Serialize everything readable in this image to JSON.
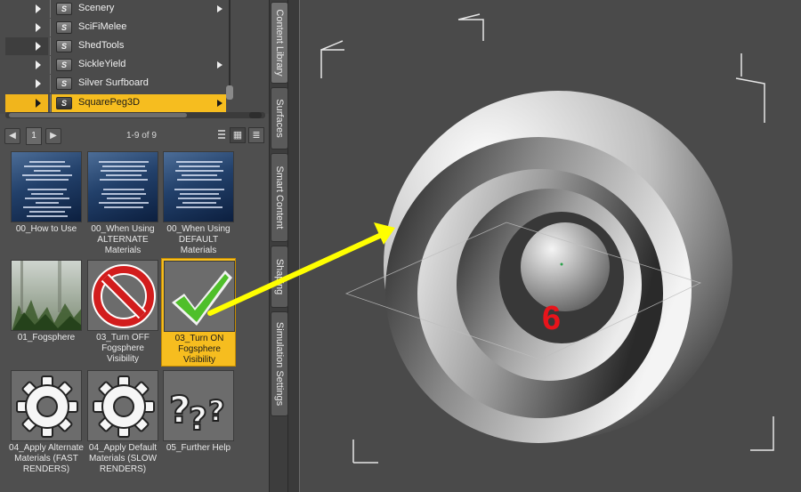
{
  "tree": {
    "items": [
      {
        "label": "Scenery",
        "has_submenu": true,
        "state": "normal"
      },
      {
        "label": "SciFiMelee",
        "has_submenu": false,
        "state": "normal"
      },
      {
        "label": "ShedTools",
        "has_submenu": false,
        "state": "dark"
      },
      {
        "label": "SickleYield",
        "has_submenu": true,
        "state": "normal"
      },
      {
        "label": "Silver Surfboard",
        "has_submenu": false,
        "state": "normal"
      },
      {
        "label": "SquarePeg3D",
        "has_submenu": true,
        "state": "selected"
      }
    ],
    "folder_icon_glyph": "S",
    "accent_color": "#f6bd1f"
  },
  "pager": {
    "prev_icon": "◀",
    "next_icon": "▶",
    "page": "1",
    "range": "1-9 of 9",
    "icon_view_glyph": "▦",
    "list_view_glyph": "≣"
  },
  "grid": {
    "items": [
      {
        "label": "00_How to Use",
        "thumb": "doc",
        "selected": false
      },
      {
        "label": "00_When Using ALTERNATE Materials",
        "thumb": "doc",
        "selected": false
      },
      {
        "label": "00_When Using DEFAULT Materials",
        "thumb": "doc",
        "selected": false
      },
      {
        "label": "01_Fogsphere",
        "thumb": "fog-photo",
        "selected": false
      },
      {
        "label": "03_Turn OFF Fogsphere Visibility",
        "thumb": "no-sign-icon",
        "selected": false
      },
      {
        "label": "03_Turn ON Fogsphere Visibility",
        "thumb": "checkmark-icon",
        "selected": true
      },
      {
        "label": "04_Apply Alternate Materials (FAST RENDERS)",
        "thumb": "gear-icon",
        "selected": false
      },
      {
        "label": "04_Apply Default Materials (SLOW RENDERS)",
        "thumb": "gear-icon",
        "selected": false
      },
      {
        "label": "05_Further Help",
        "thumb": "question-marks-icon",
        "selected": false
      }
    ]
  },
  "tabs": [
    {
      "label": "Content Library",
      "active": true
    },
    {
      "label": "Surfaces",
      "active": false
    },
    {
      "label": "Smart Content",
      "active": false
    },
    {
      "label": "Shaping",
      "active": false
    },
    {
      "label": "Simulation Settings",
      "active": false
    }
  ],
  "annotation": {
    "step_number": "6",
    "arrow_color": "#ffff00",
    "number_color": "#e8141b"
  }
}
